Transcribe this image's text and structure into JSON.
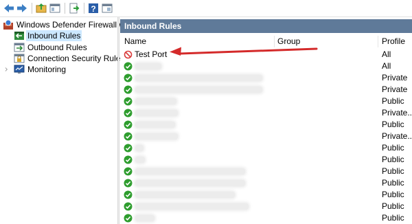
{
  "toolbar": {
    "icons": [
      "back-arrow-icon",
      "forward-arrow-icon",
      "up-folder-icon",
      "show-hide-tree-icon",
      "export-list-icon",
      "help-icon",
      "properties-icon"
    ]
  },
  "tree": {
    "root": "Windows Defender Firewall witl",
    "items": [
      {
        "label": "Inbound Rules",
        "icon": "inbound-rules-icon",
        "selected": true
      },
      {
        "label": "Outbound Rules",
        "icon": "outbound-rules-icon",
        "selected": false
      },
      {
        "label": "Connection Security Rules",
        "icon": "connection-security-icon",
        "selected": false
      },
      {
        "label": "Monitoring",
        "icon": "monitoring-icon",
        "selected": false
      }
    ]
  },
  "panel": {
    "title": "Inbound Rules",
    "columns": {
      "name": "Name",
      "group": "Group",
      "profile": "Profile"
    }
  },
  "rules": [
    {
      "name": "Test Port",
      "status": "blocked",
      "profile": "All"
    },
    {
      "name": "",
      "status": "allowed",
      "profile": "All"
    },
    {
      "name": "",
      "status": "allowed",
      "profile": "Private"
    },
    {
      "name": "",
      "status": "allowed",
      "profile": "Private"
    },
    {
      "name": "",
      "status": "allowed",
      "profile": "Public"
    },
    {
      "name": "",
      "status": "allowed",
      "profile": "Private..."
    },
    {
      "name": "",
      "status": "allowed",
      "profile": "Public"
    },
    {
      "name": "",
      "status": "allowed",
      "profile": "Private..."
    },
    {
      "name": "",
      "status": "allowed",
      "profile": "Public"
    },
    {
      "name": "",
      "status": "allowed",
      "profile": "Public"
    },
    {
      "name": "",
      "status": "allowed",
      "profile": "Public"
    },
    {
      "name": "",
      "status": "allowed",
      "profile": "Public"
    },
    {
      "name": "",
      "status": "allowed",
      "profile": "Public"
    },
    {
      "name": "",
      "status": "allowed",
      "profile": "Public"
    },
    {
      "name": "",
      "status": "allowed",
      "profile": "Public"
    }
  ],
  "annotation": {
    "icon": "red-arrow-icon",
    "color": "#d42a2a"
  },
  "colors": {
    "title_bar": "#5f7a99",
    "selection": "#cce8ff",
    "allow_green": "#2e9d2e",
    "block_red": "#d93a3a"
  }
}
